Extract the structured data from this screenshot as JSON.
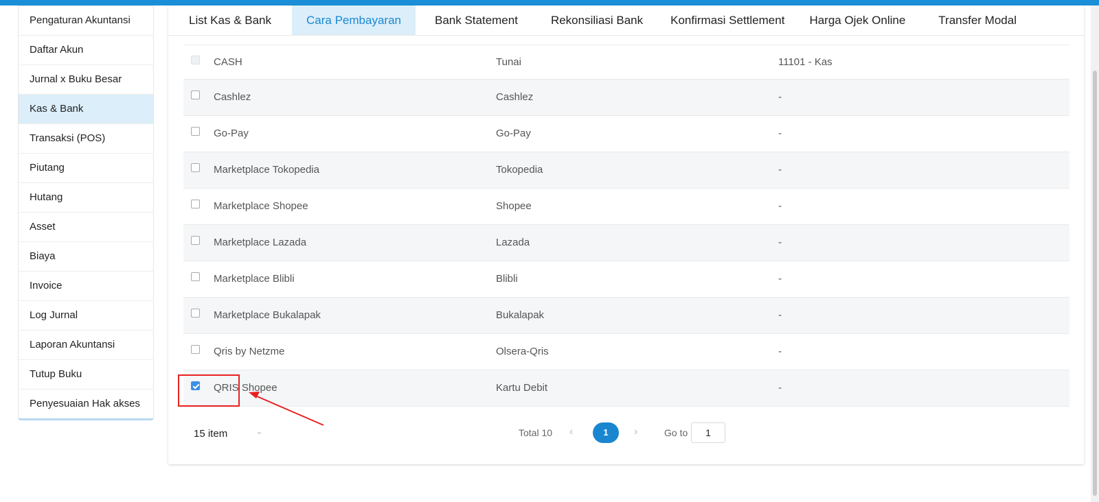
{
  "sidebar": {
    "items": [
      {
        "label": "Pengaturan Akuntansi"
      },
      {
        "label": "Daftar Akun"
      },
      {
        "label": "Jurnal x Buku Besar"
      },
      {
        "label": "Kas & Bank",
        "active": true
      },
      {
        "label": "Transaksi (POS)"
      },
      {
        "label": "Piutang"
      },
      {
        "label": "Hutang"
      },
      {
        "label": "Asset"
      },
      {
        "label": "Biaya"
      },
      {
        "label": "Invoice"
      },
      {
        "label": "Log Jurnal"
      },
      {
        "label": "Laporan Akuntansi"
      },
      {
        "label": "Tutup Buku"
      },
      {
        "label": "Penyesuaian Hak akses"
      }
    ]
  },
  "tabs": [
    {
      "label": "List Kas & Bank"
    },
    {
      "label": "Cara Pembayaran",
      "active": true
    },
    {
      "label": "Bank Statement"
    },
    {
      "label": "Rekonsiliasi Bank"
    },
    {
      "label": "Konfirmasi Settlement"
    },
    {
      "label": "Harga Ojek Online"
    },
    {
      "label": "Transfer Modal"
    }
  ],
  "table": {
    "rows": [
      {
        "name": "CASH",
        "type": "Tunai",
        "account": "11101 - Kas",
        "checked": false,
        "disabled": true
      },
      {
        "name": "Cashlez",
        "type": "Cashlez",
        "account": "-",
        "checked": false
      },
      {
        "name": "Go-Pay",
        "type": "Go-Pay",
        "account": "-",
        "checked": false
      },
      {
        "name": "Marketplace Tokopedia",
        "type": "Tokopedia",
        "account": "-",
        "checked": false
      },
      {
        "name": "Marketplace Shopee",
        "type": "Shopee",
        "account": "-",
        "checked": false
      },
      {
        "name": "Marketplace Lazada",
        "type": "Lazada",
        "account": "-",
        "checked": false
      },
      {
        "name": "Marketplace Blibli",
        "type": "Blibli",
        "account": "-",
        "checked": false
      },
      {
        "name": "Marketplace Bukalapak",
        "type": "Bukalapak",
        "account": "-",
        "checked": false
      },
      {
        "name": "Qris by Netzme",
        "type": "Olsera-Qris",
        "account": "-",
        "checked": false
      },
      {
        "name": "QRIS Shopee",
        "type": "Kartu Debit",
        "account": "-",
        "checked": true
      }
    ]
  },
  "pagination": {
    "page_size": "15 item",
    "total": "Total 10",
    "current_page": "1",
    "goto_label": "Go to",
    "goto_value": "1"
  },
  "colors": {
    "accent": "#1a86d0",
    "active_bg": "#dbeef9",
    "highlight": "#e82020"
  }
}
